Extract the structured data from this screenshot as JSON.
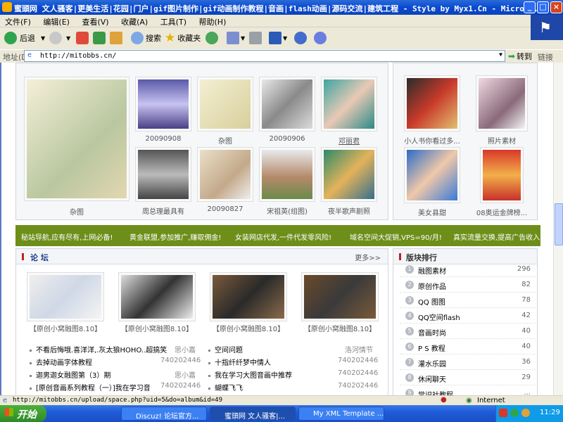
{
  "window": {
    "title": "蜜頭网 文人骚客|更美生活|花园|门户|gif图片制作|gif动画制作教程|音画|flash动画|源码交流|建筑工程 - Style by Myx1.Cn - Micro..."
  },
  "menu": [
    "文件(F)",
    "编辑(E)",
    "查看(V)",
    "收藏(A)",
    "工具(T)",
    "帮助(H)"
  ],
  "toolbar": {
    "back": "后退",
    "search": "搜索",
    "favorites": "收藏夹"
  },
  "address": {
    "label": "地址(D)",
    "url": "http://mitobbs.cn/",
    "go": "转到",
    "links": "链接"
  },
  "albums_left": [
    {
      "caption": "杂图"
    },
    {
      "caption": "20090908"
    },
    {
      "caption": "杂图"
    },
    {
      "caption": "20090906"
    },
    {
      "caption": "邓丽君"
    },
    {
      "caption": "周总理最具有"
    },
    {
      "caption": "20090827"
    },
    {
      "caption": "宋祖英(组图)"
    },
    {
      "caption": "夜半歌声剧照"
    }
  ],
  "albums_right": [
    {
      "caption": "小人书你看过多..."
    },
    {
      "caption": "照片素材"
    },
    {
      "caption": "美女县甜"
    },
    {
      "caption": "08奥运金牌榜..."
    }
  ],
  "banner": [
    "秘站导航,应有尽有,上网必备!",
    "黄金联盟,参加推广,赚取佣金!",
    "女装网店代发,一件代发零风险!",
    "域名空间大促销,VPS=90/月!",
    "真实流量交换,提高广告收入"
  ],
  "forum": {
    "title": "论 坛",
    "more": "更多>>",
    "thumbs": [
      "【原创小窝融图8.10】",
      "【原创小窝融图8.10】",
      "【原创小窝融图8.10】",
      "【原创小窝融图8.10】"
    ],
    "posts_left": [
      {
        "title": "不看后悔哦.喜洋洋,.灰太狼HOHO..超搞笑",
        "author": "思小嘉"
      },
      {
        "title": "去掉动画字体教程",
        "author": "740202446"
      },
      {
        "title": "迦男迦女融图第（3）期",
        "author": "思小嘉"
      },
      {
        "title": "[原创音画系列教程（一）]我在学习音",
        "author": "740202446"
      }
    ],
    "posts_right": [
      {
        "title": "空间问题",
        "author": "洛河情节"
      },
      {
        "title": "十指纤纤梦中情人",
        "author": "740202446"
      },
      {
        "title": "我在学习大图音画中推荐",
        "author": "740202446"
      },
      {
        "title": "蝴蝶飞飞",
        "author": "740202446"
      }
    ]
  },
  "ranking": {
    "title": "版块排行",
    "rows": [
      {
        "num": "1",
        "label": "融图素材",
        "value": "296"
      },
      {
        "num": "2",
        "label": "原创作品",
        "value": "82"
      },
      {
        "num": "3",
        "label": "QQ 图图",
        "value": "78"
      },
      {
        "num": "4",
        "label": "QQ空间flash",
        "value": "42"
      },
      {
        "num": "5",
        "label": "音画时尚",
        "value": "40"
      },
      {
        "num": "6",
        "label": "P S 教程",
        "value": "40"
      },
      {
        "num": "7",
        "label": "灌水乐园",
        "value": "36"
      },
      {
        "num": "8",
        "label": "休闲聊天",
        "value": "29"
      },
      {
        "num": "9",
        "label": "常识社教程",
        "value": "..."
      }
    ]
  },
  "status": {
    "url": "http://mitobbs.cn/upload/space.php?uid=5&do=album&id=49",
    "zone": "Internet"
  },
  "taskbar": {
    "start": "开始",
    "tasks": [
      "Discuz! 论坛官方...",
      "蜜頭网 文人骚客|...",
      "My XML Template ..."
    ],
    "time": "11:29"
  },
  "colors": {
    "banner": "#6e8e1a",
    "titlebar": "#0a4ad0",
    "taskbar": "#1f5cd8"
  }
}
